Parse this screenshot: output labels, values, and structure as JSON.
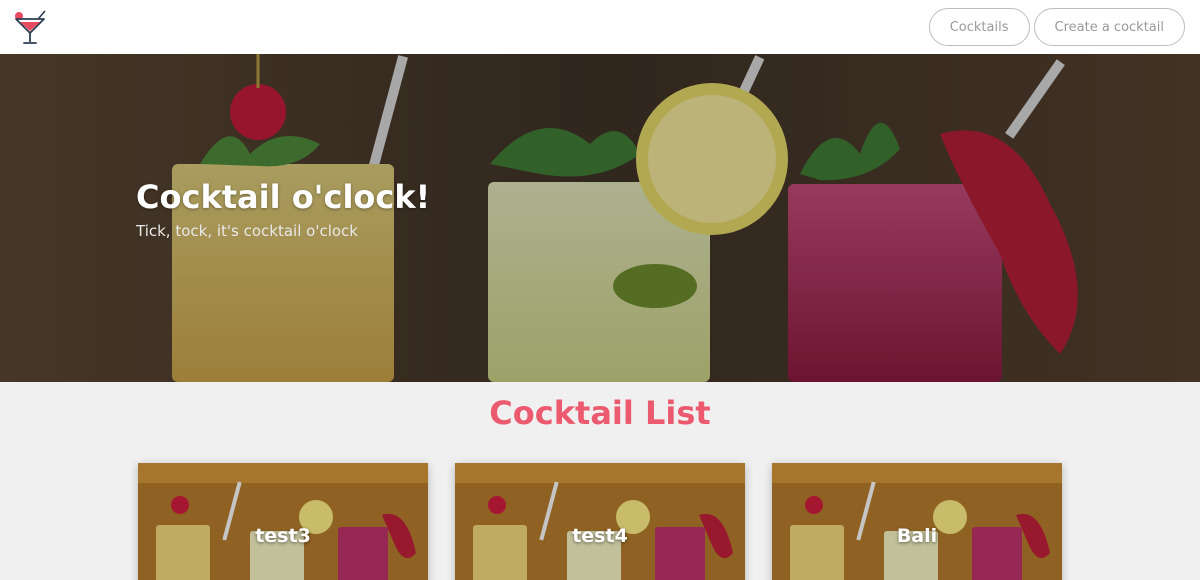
{
  "navbar": {
    "logo_icon": "cocktail-glass-icon",
    "links": [
      {
        "label": "Cocktails"
      },
      {
        "label": "Create a cocktail"
      }
    ]
  },
  "hero": {
    "title": "Cocktail o'clock!",
    "subtitle": "Tick, tock, it's cocktail o'clock"
  },
  "cocktail_list": {
    "heading": "Cocktail List",
    "cards": [
      {
        "name": "test3"
      },
      {
        "name": "test4"
      },
      {
        "name": "Bali"
      }
    ]
  },
  "colors": {
    "accent": "#ec5a6f",
    "nav_border": "#bdbdbd",
    "background": "#f0f0f0"
  }
}
